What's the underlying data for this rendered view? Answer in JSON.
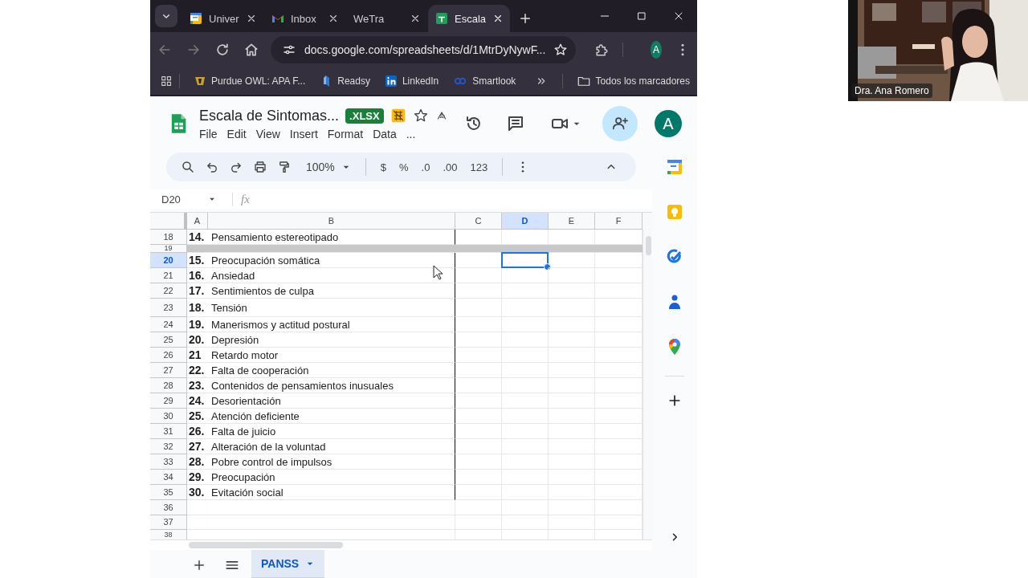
{
  "browser": {
    "tabs": [
      {
        "label": "Univer",
        "selected": false
      },
      {
        "label": "Inbox",
        "selected": false
      },
      {
        "label": "WeTra",
        "selected": false
      },
      {
        "label": "Escala",
        "selected": true
      }
    ],
    "address": "docs.google.com/spreadsheets/d/1MtrDyNywF...",
    "profile": "A",
    "bookmarks": [
      {
        "label": "Purdue OWL: APA F..."
      },
      {
        "label": "Readsy"
      },
      {
        "label": "LinkedIn"
      },
      {
        "label": "Smartlook"
      }
    ],
    "all_bookmarks": "Todos los marcadores"
  },
  "sheet": {
    "title": "Escala de Sintomas...",
    "badge": ".XLSX",
    "menu": [
      "File",
      "Edit",
      "View",
      "Insert",
      "Format",
      "Data",
      "..."
    ],
    "avatar": "A",
    "zoom": "100%",
    "format_buttons": [
      "$",
      "%",
      ".0",
      ".00",
      "123"
    ],
    "name_box": "D20",
    "formula_label": "fx",
    "columns": [
      {
        "label": "A",
        "selected": false
      },
      {
        "label": "B",
        "selected": false
      },
      {
        "label": "C",
        "selected": false
      },
      {
        "label": "D",
        "selected": true
      },
      {
        "label": "E",
        "selected": false
      },
      {
        "label": "F",
        "selected": false
      }
    ],
    "rows": [
      {
        "number": "18",
        "item_number": "14.",
        "item": "Pensamiento estereotipado",
        "selected": false,
        "shaded": false
      },
      {
        "number": "19",
        "selected": false,
        "shaded": true
      },
      {
        "number": "20",
        "item_number": "15.",
        "item": "Preocupación somática",
        "selected": true,
        "shaded": false
      },
      {
        "number": "21",
        "item_number": "16.",
        "item": "Ansiedad",
        "selected": false,
        "shaded": false
      },
      {
        "number": "22",
        "item_number": "17.",
        "item": "Sentimientos de culpa",
        "selected": false,
        "shaded": false
      },
      {
        "number": "23",
        "item_number": "18.",
        "item": "Tensión",
        "selected": false,
        "shaded": false
      },
      {
        "number": "24",
        "item_number": "19.",
        "item": "Manerismos y actitud postural",
        "selected": false,
        "shaded": false
      },
      {
        "number": "25",
        "item_number": "20.",
        "item": "Depresión",
        "selected": false,
        "shaded": false
      },
      {
        "number": "26",
        "item_number": "21",
        "item": "Retardo motor",
        "selected": false,
        "shaded": false
      },
      {
        "number": "27",
        "item_number": "22.",
        "item": "Falta de cooperación",
        "selected": false,
        "shaded": false
      },
      {
        "number": "28",
        "item_number": "23.",
        "item": "Contenidos de pensamientos inusuales",
        "selected": false,
        "shaded": false
      },
      {
        "number": "29",
        "item_number": "24.",
        "item": "Desorientación",
        "selected": false,
        "shaded": false
      },
      {
        "number": "30",
        "item_number": "25.",
        "item": "Atención deficiente",
        "selected": false,
        "shaded": false
      },
      {
        "number": "31",
        "item_number": "26.",
        "item": "Falta de juicio",
        "selected": false,
        "shaded": false
      },
      {
        "number": "32",
        "item_number": "27.",
        "item": "Alteración de la voluntad",
        "selected": false,
        "shaded": false
      },
      {
        "number": "33",
        "item_number": "28.",
        "item": "Pobre control de impulsos",
        "selected": false,
        "shaded": false
      },
      {
        "number": "34",
        "item_number": "29.",
        "item": "Preocupación",
        "selected": false,
        "shaded": false
      },
      {
        "number": "35",
        "item_number": "30.",
        "item": "Evitación social",
        "selected": false,
        "shaded": false
      },
      {
        "number": "36",
        "selected": false,
        "shaded": false
      },
      {
        "number": "37",
        "selected": false,
        "shaded": false
      },
      {
        "number": "38",
        "selected": false,
        "shaded": false
      }
    ],
    "sheet_tabs": [
      {
        "label": "PANSS",
        "selected": true
      }
    ]
  },
  "video": {
    "participant": "Dra. Ana Romero"
  }
}
